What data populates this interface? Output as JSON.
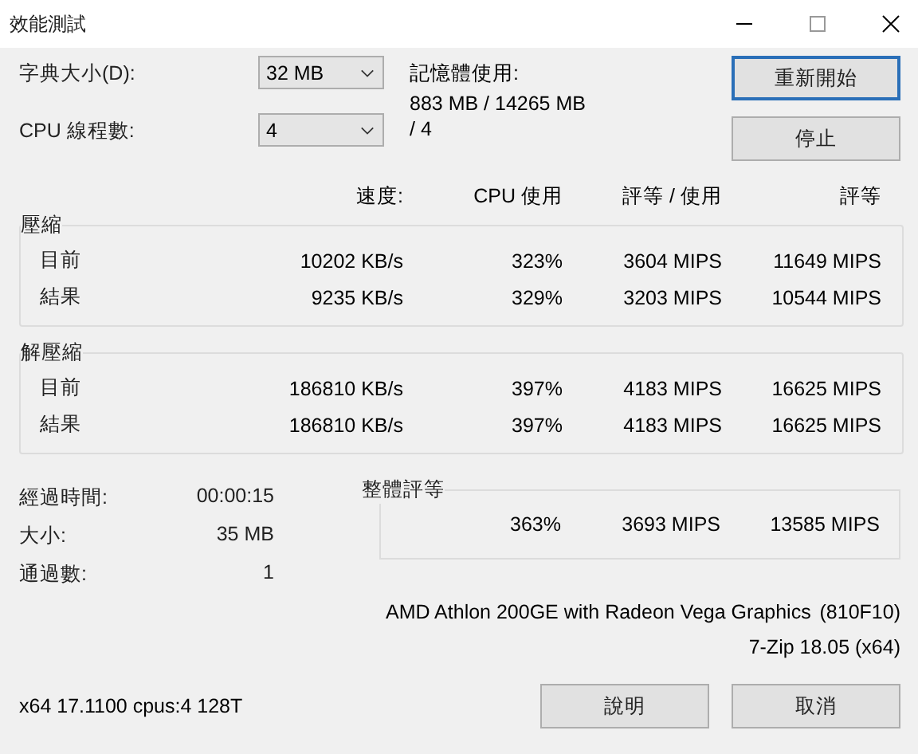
{
  "window": {
    "title": "效能測試"
  },
  "settings": [
    {
      "label": "字典大小(D):",
      "value": "32 MB",
      "info": [
        "記憶體使用:",
        "883 MB / 14265 MB"
      ]
    },
    {
      "label": "CPU 線程數:",
      "value": "4",
      "info": [
        "/ 4"
      ]
    }
  ],
  "side_buttons": [
    {
      "label": "重新開始",
      "default": true
    },
    {
      "label": "停止",
      "default": false
    }
  ],
  "columns": [
    "速度:",
    "CPU 使用",
    "評等 / 使用",
    "評等"
  ],
  "groups": [
    {
      "title": "壓縮",
      "rows": [
        {
          "label": "目前",
          "cells": [
            "10202 KB/s",
            "323%",
            "3604 MIPS",
            "11649 MIPS"
          ]
        },
        {
          "label": "結果",
          "cells": [
            "9235 KB/s",
            "329%",
            "3203 MIPS",
            "10544 MIPS"
          ]
        }
      ]
    },
    {
      "title": "解壓縮",
      "rows": [
        {
          "label": "目前",
          "cells": [
            "186810 KB/s",
            "397%",
            "4183 MIPS",
            "16625 MIPS"
          ]
        },
        {
          "label": "結果",
          "cells": [
            "186810 KB/s",
            "397%",
            "4183 MIPS",
            "16625 MIPS"
          ]
        }
      ]
    }
  ],
  "stats": [
    {
      "label": "經過時間:",
      "value": "00:00:15"
    },
    {
      "label": "大小:",
      "value": "35 MB"
    },
    {
      "label": "通過數:",
      "value": "1"
    }
  ],
  "total": {
    "title": "整體評等",
    "cells": [
      "363%",
      "3693 MIPS",
      "13585 MIPS"
    ]
  },
  "cpu": {
    "name": "AMD Athlon 200GE with Radeon Vega Graphics",
    "id": "(810F10)"
  },
  "version": "7-Zip 18.05 (x64)",
  "system_info": "x64 17.1100 cpus:4 128T",
  "footer_buttons": [
    "說明",
    "取消"
  ]
}
